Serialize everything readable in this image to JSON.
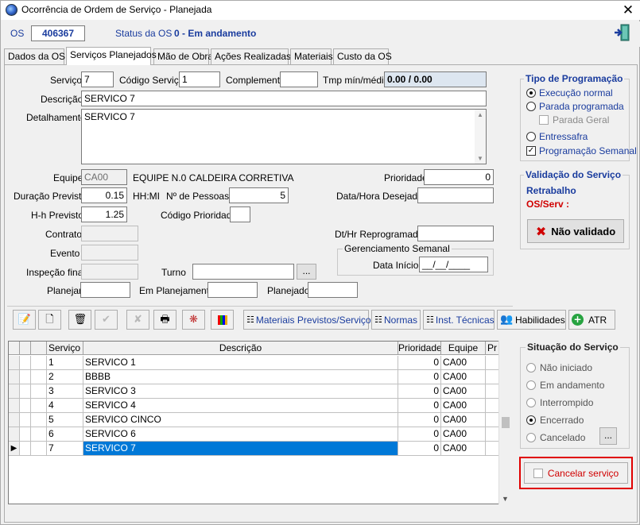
{
  "window": {
    "title": "Ocorrência de Ordem de Serviço - Planejada",
    "close": "✕"
  },
  "header": {
    "os_label": "OS",
    "os_number": "406367",
    "status_label": "Status da OS",
    "status_value": "0 - Em andamento"
  },
  "tabs": [
    "Dados da OS",
    "Serviços Planejados",
    "Mão de Obra",
    "Ações Realizadas",
    "Materiais",
    "Custo da OS"
  ],
  "form": {
    "servico_label": "Serviço",
    "servico_value": "7",
    "codigo_servico_label": "Código Serviço",
    "codigo_servico_value": "1",
    "complemento_label": "Complemento",
    "complemento_value": "",
    "tmp_label": "Tmp mín/médio",
    "tmp_value": "0.00 / 0.00",
    "descricao_label": "Descrição",
    "descricao_value": "SERVICO 7",
    "detalhamento_label": "Detalhamento",
    "detalhamento_value": "SERVICO 7",
    "equipe_label": "Equipe",
    "equipe_code": "CA00",
    "equipe_name": "EQUIPE N.0 CALDEIRA CORRETIVA",
    "prioridade_label": "Prioridade",
    "prioridade_value": "0",
    "duracao_label": "Duração Prevista",
    "duracao_value": "0.15",
    "duracao_unit": "HH:MI",
    "pessoas_label": "Nº de Pessoas",
    "pessoas_value": "5",
    "data_desejada_label": "Data/Hora Desejada",
    "data_desejada_value": "",
    "hh_label": "H-h Previsto",
    "hh_value": "1.25",
    "cod_prioridade_label": "Código Prioridade",
    "cod_prioridade_value": "",
    "contrato_label": "Contrato",
    "contrato_value": "",
    "reprogramada_label": "Dt/Hr Reprogramada",
    "reprogramada_value": "",
    "evento_label": "Evento",
    "evento_value": "",
    "gerenciamento_title": "Gerenciamento Semanal",
    "data_inicio_label": "Data Início",
    "data_inicio_value": "__/__/____",
    "inspecao_label": "Inspeção final",
    "inspecao_value": "",
    "turno_label": "Turno",
    "turno_value": "",
    "turno_btn": "...",
    "planejar_label": "Planejar",
    "planejar_value": "",
    "em_planejamento_label": "Em Planejamento",
    "em_planejamento_value": "",
    "planejado_label": "Planejado",
    "planejado_value": ""
  },
  "tipo_programacao": {
    "title": "Tipo de Programação",
    "options": [
      "Execução normal",
      "Parada programada",
      "Parada Geral",
      "Entressafra",
      "Programação Semanal"
    ],
    "check": "✓"
  },
  "validacao": {
    "title": "Validação do Serviço",
    "retrabalho": "Retrabalho",
    "os_serv": "OS/Serv :",
    "button": "Não validado"
  },
  "toolbar": {
    "materiais": "Materiais Previstos/Serviços",
    "normas": "Normas",
    "inst": "Inst. Técnicas",
    "habilidades": "Habilidades",
    "atr": "ATR"
  },
  "grid": {
    "headers": [
      "Serviço",
      "Descrição",
      "Prioridade",
      "Equipe",
      "Pr"
    ],
    "rows": [
      [
        "1",
        "SERVICO 1",
        "0",
        "CA00"
      ],
      [
        "2",
        "BBBB",
        "0",
        "CA00"
      ],
      [
        "3",
        "SERVICO 3",
        "0",
        "CA00"
      ],
      [
        "4",
        "SERVICO 4",
        "0",
        "CA00"
      ],
      [
        "5",
        "SERVICO CINCO",
        "0",
        "CA00"
      ],
      [
        "6",
        "SERVICO 6",
        "0",
        "CA00"
      ],
      [
        "7",
        "SERVICO 7",
        "0",
        "CA00"
      ]
    ],
    "selected_row": 7
  },
  "situacao": {
    "title": "Situação do Serviço",
    "options": [
      "Não iniciado",
      "Em andamento",
      "Interrompido",
      "Encerrado",
      "Cancelado"
    ],
    "selected": "Encerrado",
    "btn": "..."
  },
  "cancelar": {
    "label": "Cancelar serviço"
  },
  "colors": {
    "accent": "#1a3c9e",
    "selection": "#0078d7",
    "highlight_border": "#e00000"
  }
}
